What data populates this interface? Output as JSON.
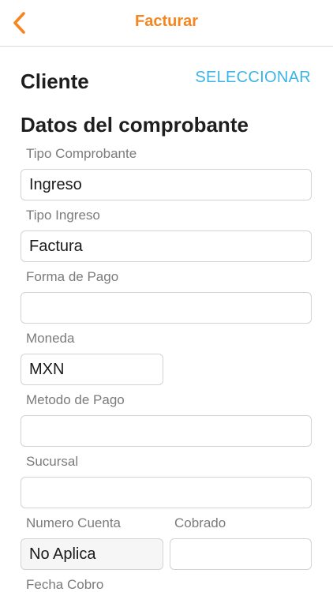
{
  "nav": {
    "title": "Facturar",
    "back_icon": "chevron-left-icon",
    "accent_color": "#f5861f"
  },
  "cliente": {
    "title": "Cliente",
    "select_label": "SELECCIONAR",
    "link_color": "#3cb4e5"
  },
  "comprobante": {
    "title": "Datos del comprobante",
    "fields": {
      "tipo_comprobante": {
        "label": "Tipo Comprobante",
        "value": "Ingreso"
      },
      "tipo_ingreso": {
        "label": "Tipo Ingreso",
        "value": "Factura"
      },
      "forma_pago": {
        "label": "Forma de Pago",
        "value": ""
      },
      "moneda": {
        "label": "Moneda",
        "value": "MXN"
      },
      "metodo_pago": {
        "label": "Metodo de Pago",
        "value": ""
      },
      "sucursal": {
        "label": "Sucursal",
        "value": ""
      },
      "numero_cuenta": {
        "label": "Numero Cuenta",
        "value": "No Aplica"
      },
      "cobrado": {
        "label": "Cobrado",
        "value": ""
      },
      "fecha_cobro": {
        "label": "Fecha Cobro",
        "value": ""
      }
    }
  }
}
